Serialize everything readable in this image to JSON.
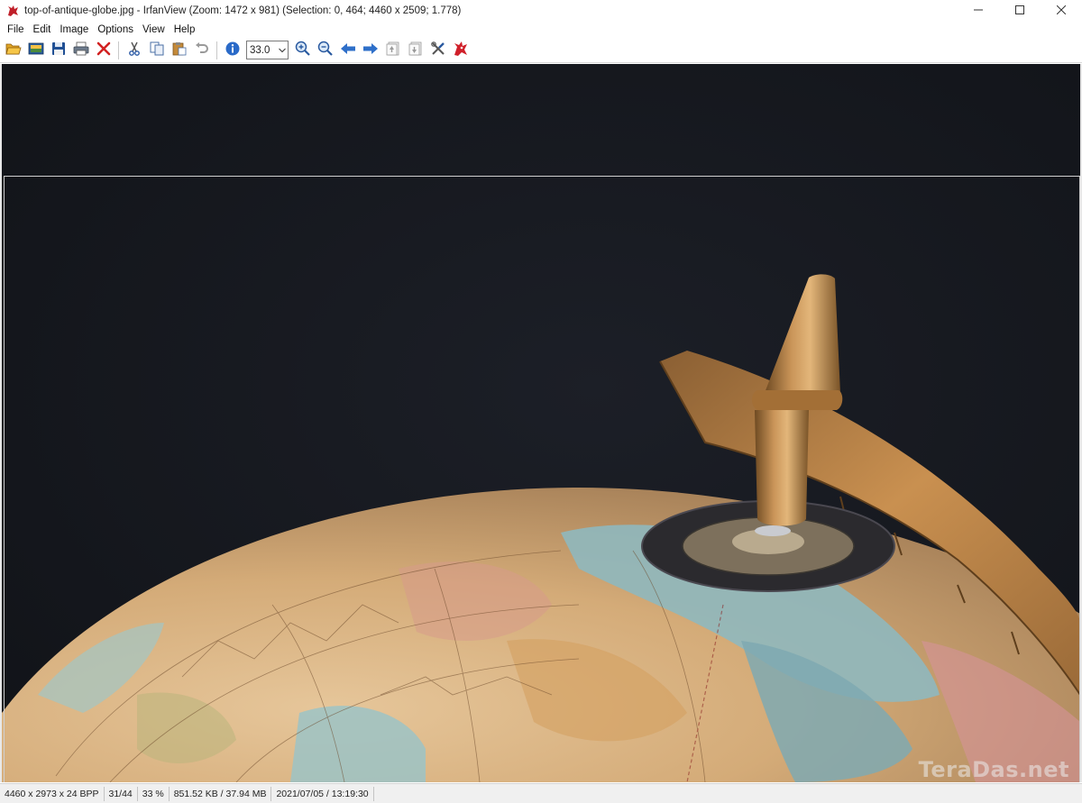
{
  "window": {
    "title": "top-of-antique-globe.jpg - IrfanView (Zoom: 1472 x 981) (Selection: 0, 464; 4460 x 2509; 1.778)",
    "icon": "irfanview-cat-icon",
    "controls": {
      "minimize_icon": "minimize-icon",
      "maximize_icon": "maximize-icon",
      "close_icon": "close-icon"
    }
  },
  "menu": {
    "items": [
      {
        "label": "File"
      },
      {
        "label": "Edit"
      },
      {
        "label": "Image"
      },
      {
        "label": "Options"
      },
      {
        "label": "View"
      },
      {
        "label": "Help"
      }
    ]
  },
  "toolbar": {
    "zoom_value": "33.0",
    "buttons": [
      "open-icon",
      "slideshow-icon",
      "save-icon",
      "print-icon",
      "delete-icon",
      "cut-icon",
      "copy-icon",
      "paste-icon",
      "undo-icon",
      "info-icon",
      "zoom-in-icon",
      "zoom-out-icon",
      "previous-icon",
      "next-icon",
      "first-page-icon",
      "last-page-icon",
      "settings-icon",
      "irfanview-icon"
    ]
  },
  "viewer": {
    "watermark": "TeraDas.net",
    "colors": {
      "background": "#15171d",
      "globe_base": "#d9b98c",
      "ocean": "#8fb8be",
      "brass": "#b07a40"
    }
  },
  "status": {
    "dimensions": "4460 x 2973 x 24 BPP",
    "index": "31/44",
    "zoom": "33 %",
    "size": "851.52 KB / 37.94 MB",
    "datetime": "2021/07/05 / 13:19:30"
  }
}
